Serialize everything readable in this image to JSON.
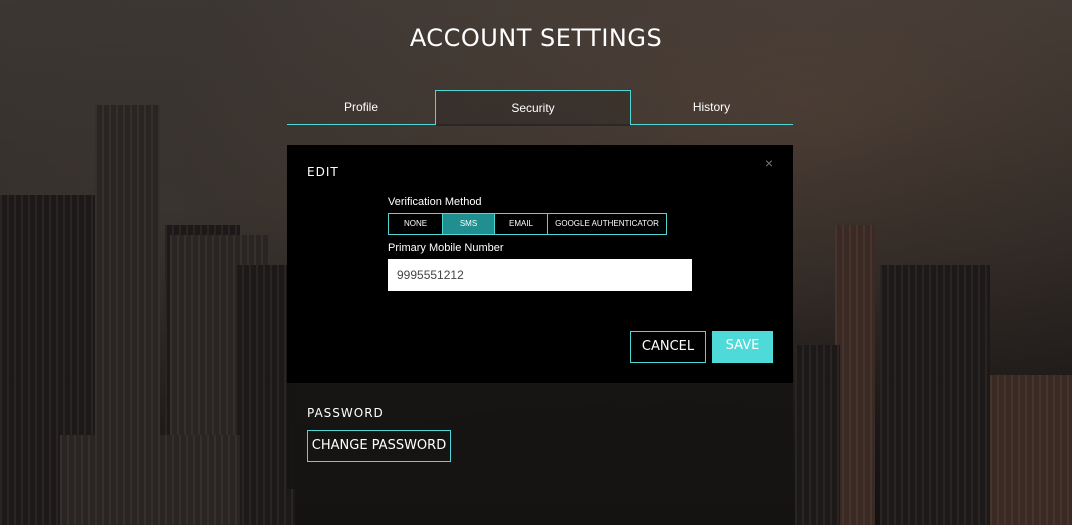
{
  "page": {
    "title": "ACCOUNT SETTINGS"
  },
  "tabs": [
    {
      "label": "Profile",
      "active": false
    },
    {
      "label": "Security",
      "active": true
    },
    {
      "label": "History",
      "active": false
    }
  ],
  "edit": {
    "title": "EDIT",
    "close_icon": "×",
    "verification": {
      "label": "Verification Method",
      "options": [
        "NONE",
        "SMS",
        "EMAIL",
        "GOOGLE AUTHENTICATOR"
      ],
      "selected": "SMS"
    },
    "phone": {
      "label": "Primary Mobile Number",
      "value": "9995551212"
    },
    "cancel_label": "CANCEL",
    "save_label": "SAVE"
  },
  "password": {
    "title": "PASSWORD",
    "button_label": "CHANGE PASSWORD"
  },
  "colors": {
    "accent": "#4fd6d6",
    "selected": "#1f8f8f"
  }
}
